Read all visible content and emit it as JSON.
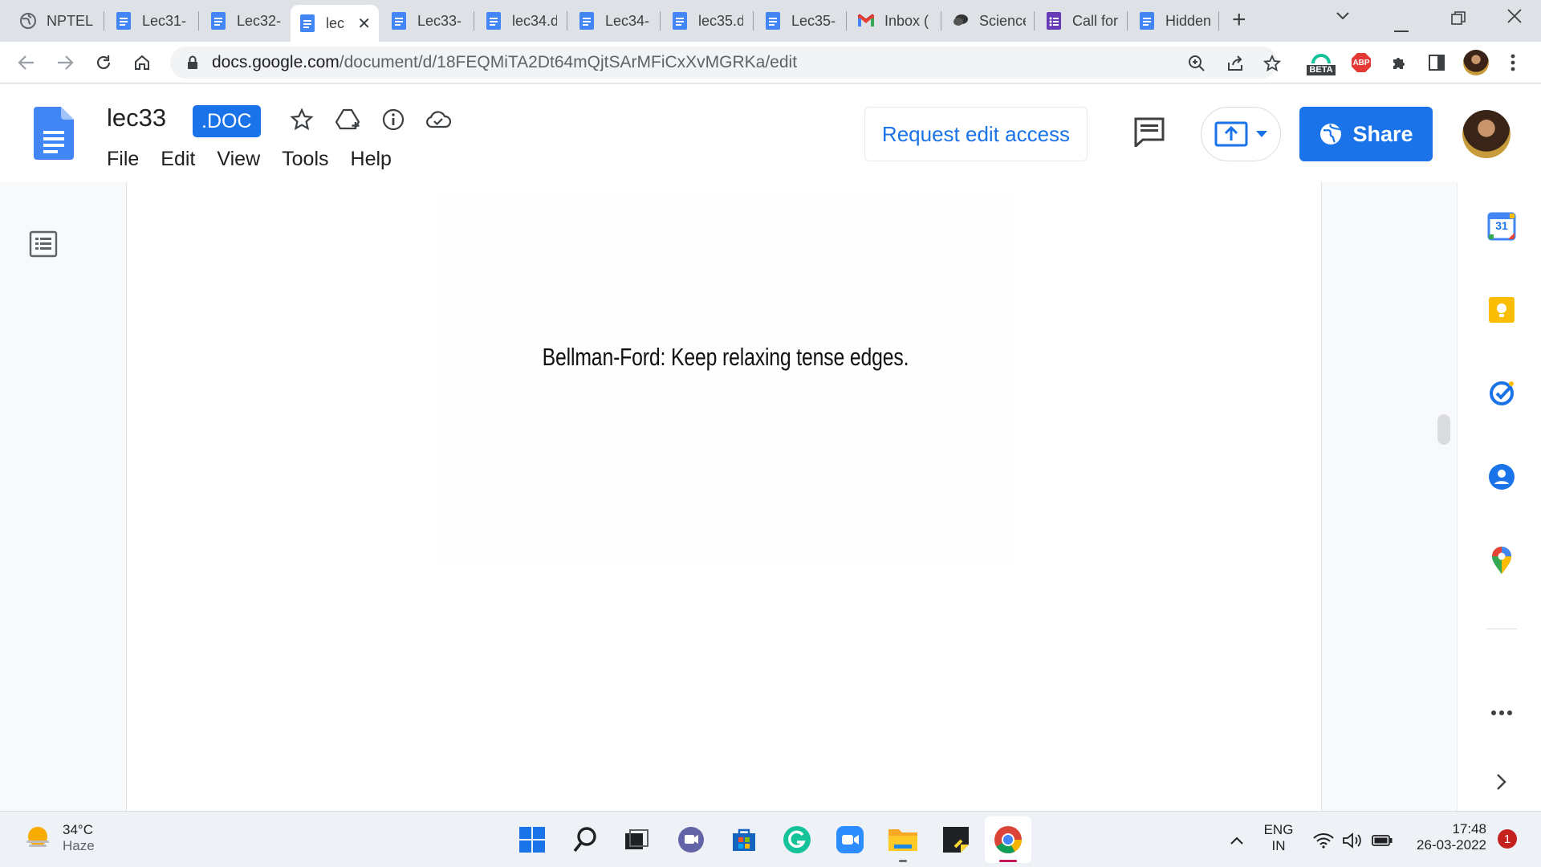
{
  "browser": {
    "tabs": [
      {
        "title": "NPTEL",
        "icon": "globe-icon"
      },
      {
        "title": "Lec31-",
        "icon": "docs-icon"
      },
      {
        "title": "Lec32-",
        "icon": "docs-icon"
      },
      {
        "title": "lec",
        "icon": "docs-icon",
        "active": true
      },
      {
        "title": "Lec33-",
        "icon": "docs-icon"
      },
      {
        "title": "lec34.d",
        "icon": "docs-icon"
      },
      {
        "title": "Lec34-",
        "icon": "docs-icon"
      },
      {
        "title": "lec35.d",
        "icon": "docs-icon"
      },
      {
        "title": "Lec35-",
        "icon": "docs-icon"
      },
      {
        "title": "Inbox (",
        "icon": "gmail-icon"
      },
      {
        "title": "Science",
        "icon": "chat-icon"
      },
      {
        "title": "Call for",
        "icon": "forms-icon"
      },
      {
        "title": "Hidden",
        "icon": "docs-icon"
      }
    ],
    "url_host": "docs.google.com",
    "url_path": "/document/d/18FEQMiTA2Dt64mQjtSArMFiCxXvMGRKa/edit",
    "ext_beta_label": "BETA",
    "ext_abp_label": "ABP"
  },
  "doc": {
    "title": "lec33",
    "badge": ".DOC",
    "menu": [
      "File",
      "Edit",
      "View",
      "Tools",
      "Help"
    ],
    "request_access_label": "Request edit access",
    "share_label": "Share",
    "slide_text": "Bellman-Ford: Keep relaxing tense edges."
  },
  "side_panel": {
    "calendar_day": "31"
  },
  "taskbar": {
    "temperature": "34°C",
    "weather": "Haze",
    "lang_top": "ENG",
    "lang_bottom": "IN",
    "time": "17:48",
    "date": "26-03-2022",
    "notifications": "1"
  },
  "colors": {
    "accent": "#1a73e8",
    "tabstrip": "#dee1e6",
    "taskbar": "#eef1f6"
  }
}
